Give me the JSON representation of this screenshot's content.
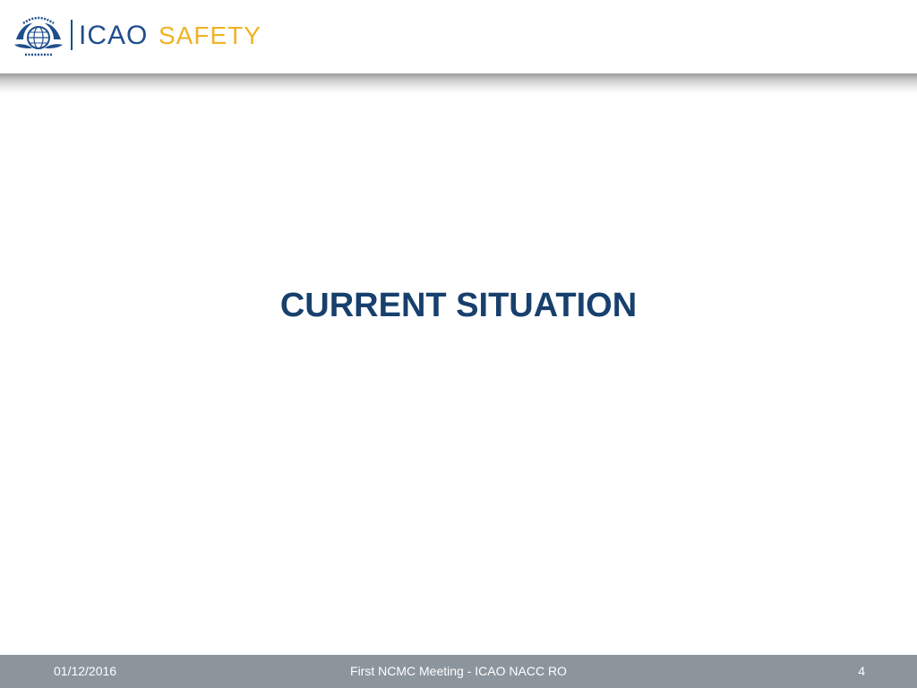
{
  "header": {
    "logo_org": "ICAO",
    "logo_tagline": "SAFETY",
    "emblem_icon": "icao-emblem-icon",
    "colors": {
      "brand_blue": "#1f4e8c",
      "tagline_gold": "#f0b323"
    }
  },
  "slide": {
    "title": "CURRENT SITUATION",
    "title_color": "#17406d"
  },
  "footer": {
    "date": "01/12/2016",
    "center_text": "First NCMC Meeting - ICAO NACC RO",
    "page_number": "4",
    "background": "#8c959c"
  }
}
